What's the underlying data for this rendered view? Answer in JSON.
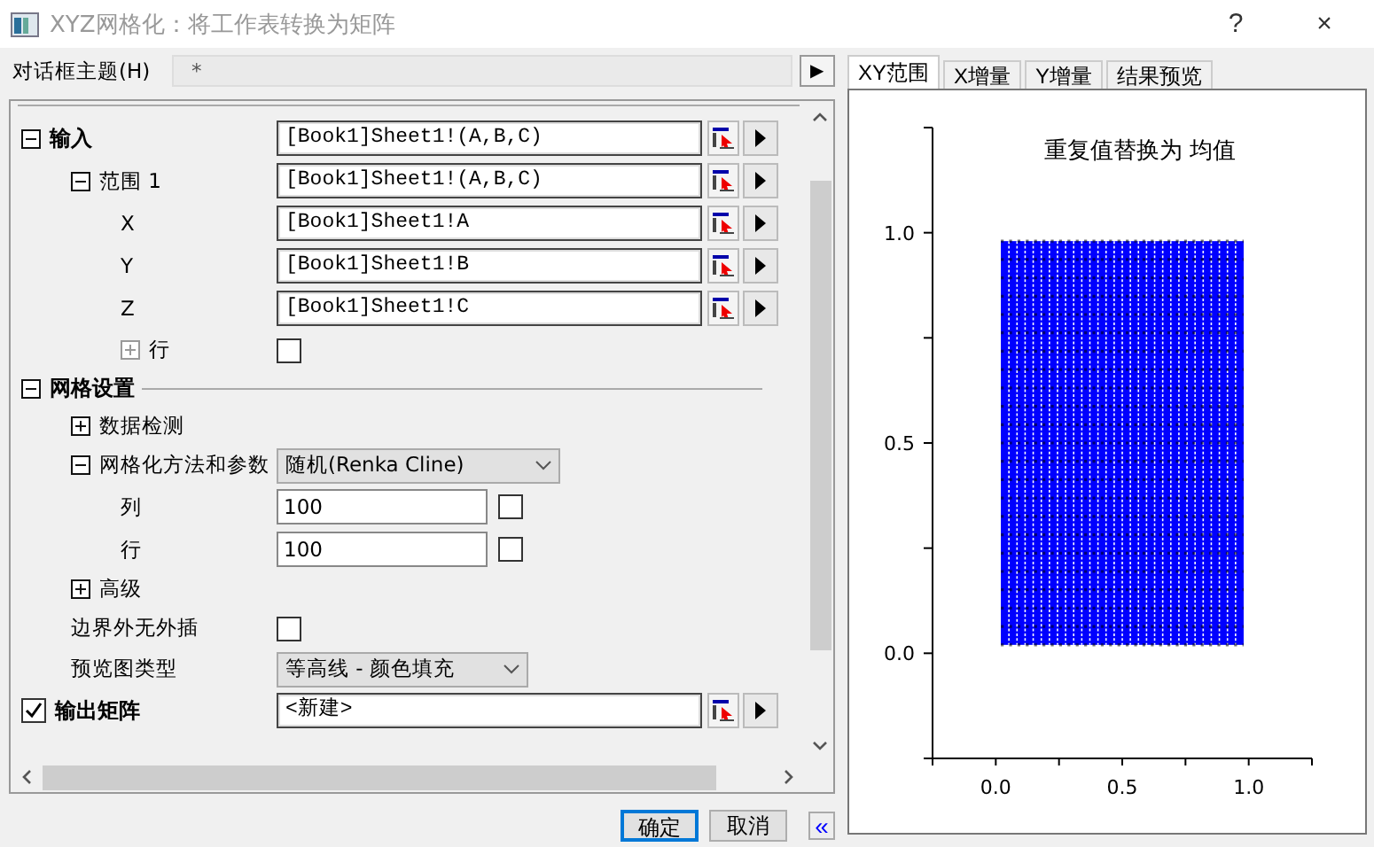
{
  "window": {
    "title": "XYZ网格化：将工作表转换为矩阵",
    "help": "?",
    "close": "×"
  },
  "theme": {
    "label": "对话框主题(H)",
    "value": "*",
    "arrow": "▶"
  },
  "tree": [
    {
      "kind": "range",
      "label": "输入",
      "bold": true,
      "expanded": true,
      "value": "[Book1]Sheet1!(A,B,C)",
      "children": [
        {
          "kind": "range",
          "label": "范围 1",
          "expanded": true,
          "value": "[Book1]Sheet1!(A,B,C)",
          "children": [
            {
              "kind": "range",
              "label": "X",
              "value": "[Book1]Sheet1!A"
            },
            {
              "kind": "range",
              "label": "Y",
              "value": "[Book1]Sheet1!B"
            },
            {
              "kind": "range",
              "label": "Z",
              "value": "[Book1]Sheet1!C"
            },
            {
              "kind": "checkbox",
              "label": "行",
              "expanded": false,
              "disabled": true,
              "checked": false
            }
          ]
        }
      ]
    },
    {
      "kind": "section",
      "label": "网格设置",
      "bold": true,
      "expanded": true,
      "children": [
        {
          "kind": "plain",
          "label": "数据检测",
          "expanded": false
        },
        {
          "kind": "dropdown",
          "label": "网格化方法和参数",
          "expanded": true,
          "value": "随机(Renka Cline)",
          "children": [
            {
              "kind": "number",
              "label": "列",
              "value": "100",
              "checked": false
            },
            {
              "kind": "number",
              "label": "行",
              "value": "100",
              "checked": false
            }
          ]
        },
        {
          "kind": "plain",
          "label": "高级",
          "expanded": false
        },
        {
          "kind": "checkbox",
          "label": "边界外无外插",
          "checked": false
        },
        {
          "kind": "dropdown",
          "label": "预览图类型",
          "value": "等高线 - 颜色填充",
          "narrow": true
        }
      ]
    },
    {
      "kind": "range",
      "label": "输出矩阵",
      "bold": true,
      "checked": true,
      "value": "<新建>"
    }
  ],
  "buttons": [
    {
      "label": "确定",
      "default": true
    },
    {
      "label": "取消",
      "default": false
    }
  ],
  "collapse": "«",
  "tabs": [
    {
      "label": "XY范围",
      "selected": true
    },
    {
      "label": "X增量",
      "selected": false
    },
    {
      "label": "Y增量",
      "selected": false
    },
    {
      "label": "结果预览",
      "selected": false
    }
  ],
  "preview": {
    "title": "重复值替换为 均值",
    "x_tick_labels": [
      "0.0",
      "0.5",
      "1.0"
    ],
    "y_tick_labels": [
      "1.0",
      "0.5",
      "0.0"
    ]
  }
}
